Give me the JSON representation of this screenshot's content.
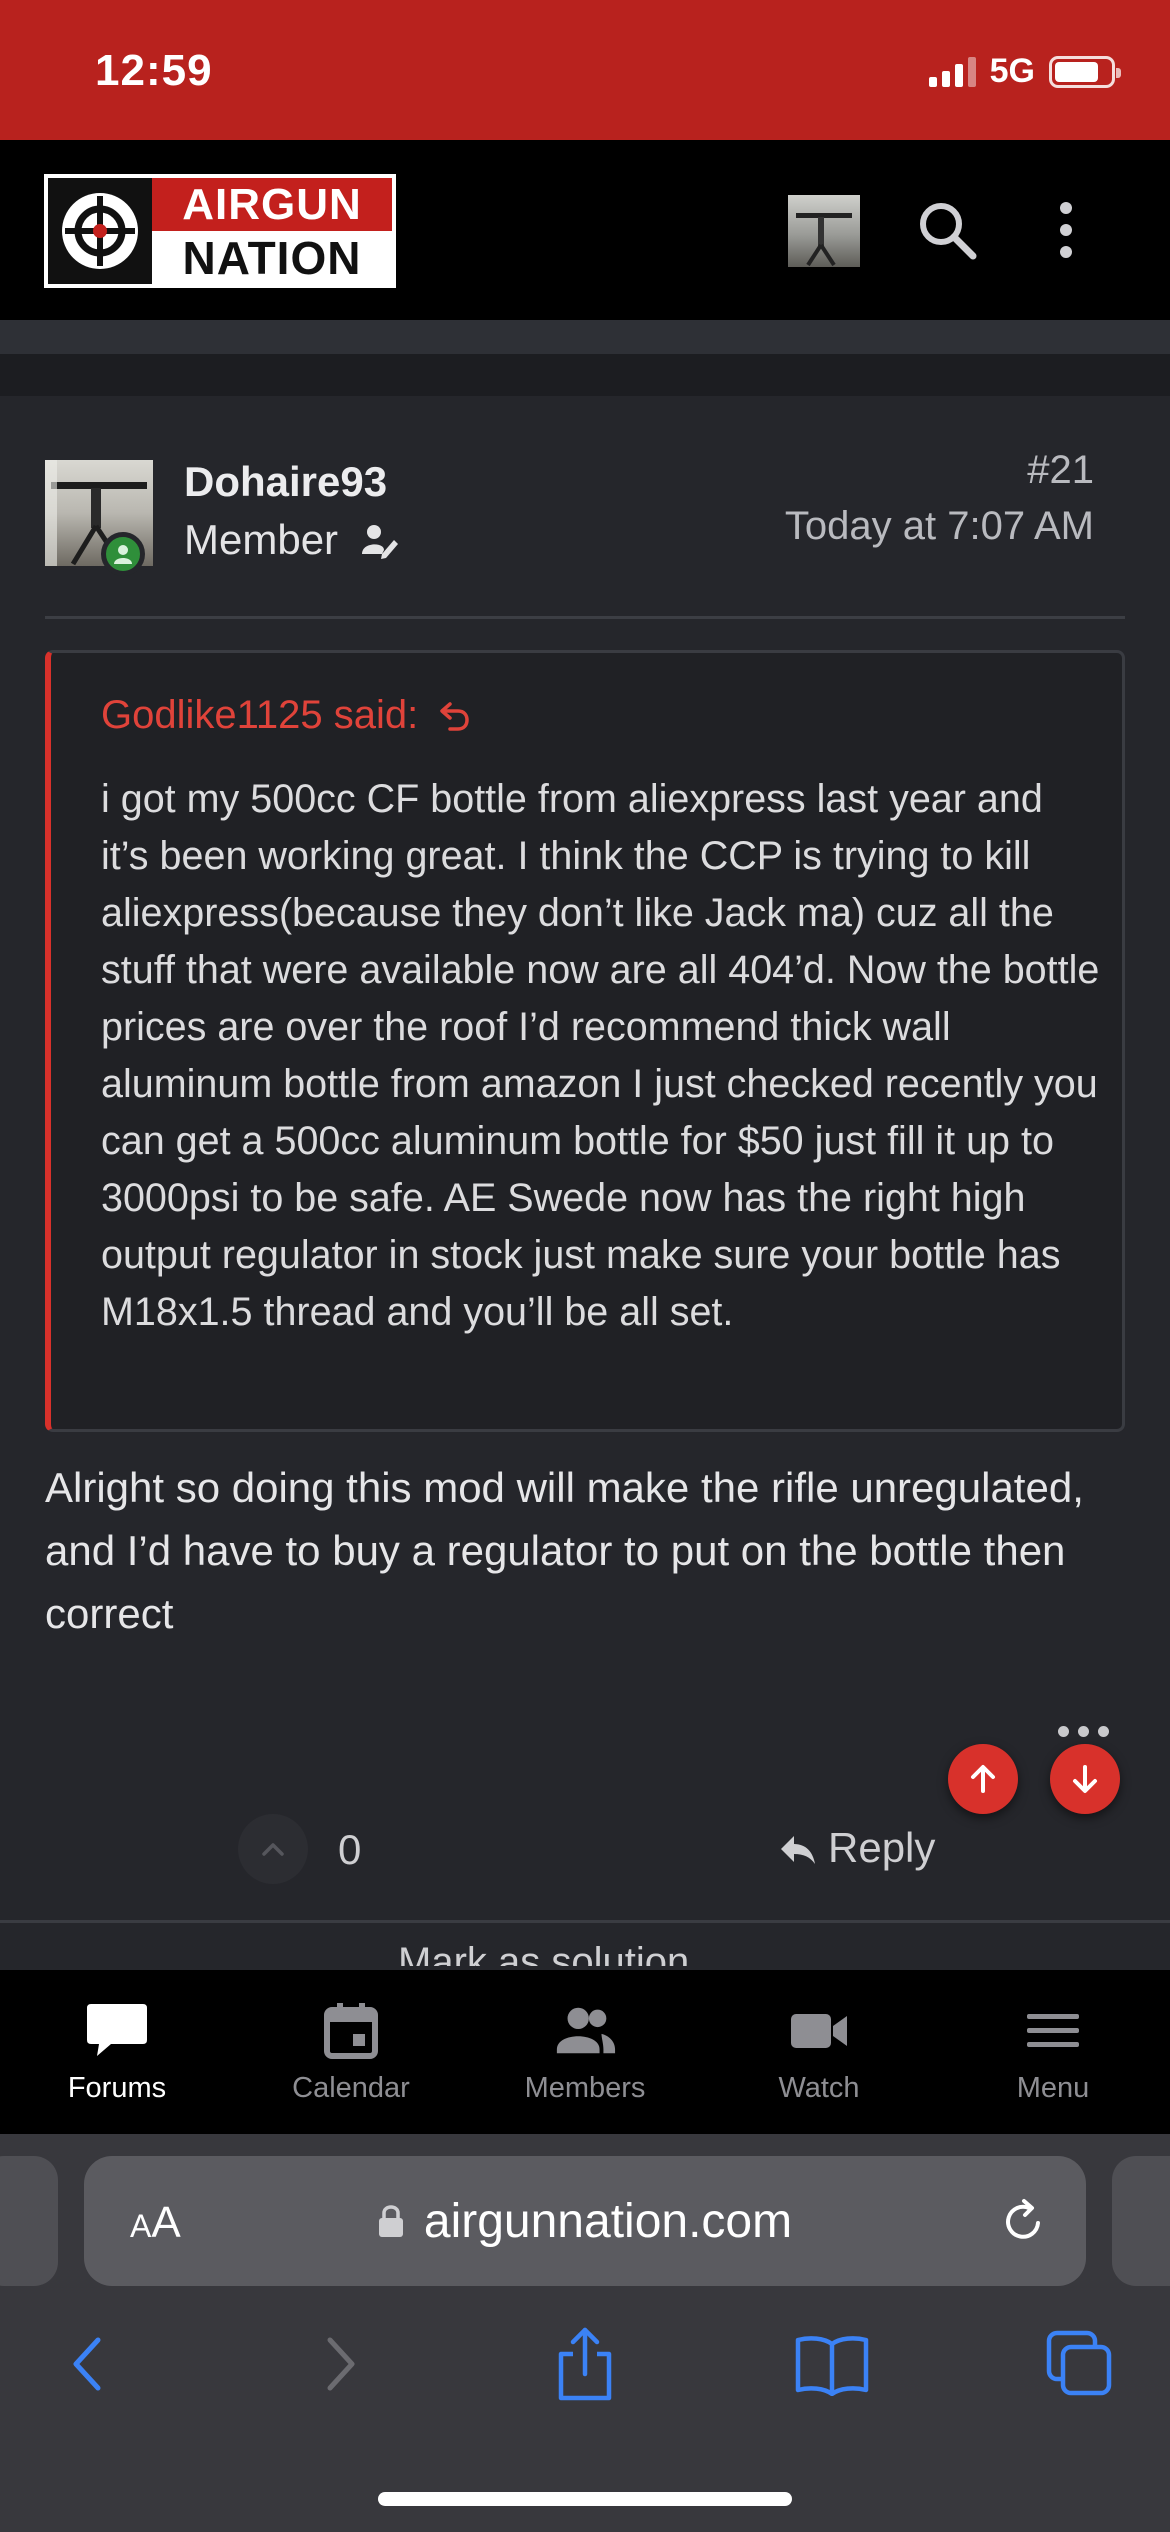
{
  "status_bar": {
    "time": "12:59",
    "network": "5G"
  },
  "header": {
    "logo_top": "AIRGUN",
    "logo_bottom": "NATION"
  },
  "post": {
    "username": "Dohaire93",
    "user_title": "Member",
    "post_number": "#21",
    "date": "Today at 7:07 AM",
    "quote_author": "Godlike1125 said:",
    "quote_text": "i got my 500cc CF bottle from aliexpress last year and it’s been working great. I think the CCP is trying to kill aliexpress(because they don’t like Jack ma) cuz all the stuff that were available now are all 404’d. Now the bottle prices are over the roof I’d recommend thick wall aluminum bottle from amazon I just checked recently you can get a 500cc aluminum bottle for $50 just fill it up to 3000psi to be safe. AE Swede now has the right high output regulator in stock just make sure your bottle has M18x1.5 thread and you’ll be all set.",
    "body": "Alright so doing this mod will make the rifle unregulated, and I’d have to buy a regulator to put on the bottle then correct",
    "reaction_count": "0",
    "reply_label": "Reply",
    "solution_label": "Mark as solution"
  },
  "bottom_nav": {
    "items": [
      {
        "label": "Forums",
        "icon": "forums-icon",
        "active": true
      },
      {
        "label": "Calendar",
        "icon": "calendar-icon",
        "active": false
      },
      {
        "label": "Members",
        "icon": "members-icon",
        "active": false
      },
      {
        "label": "Watch",
        "icon": "video-camera-icon",
        "active": false
      },
      {
        "label": "Menu",
        "icon": "hamburger-menu-icon",
        "active": false
      }
    ]
  },
  "safari": {
    "text_size_label_small": "A",
    "text_size_label_large": "A",
    "url": "airgunnation.com"
  },
  "colors": {
    "brand_red": "#b8221e",
    "accent_red": "#d8312b",
    "background": "#25262b",
    "online_green": "#2f8f3a",
    "ios_blue": "#3b82f6"
  }
}
